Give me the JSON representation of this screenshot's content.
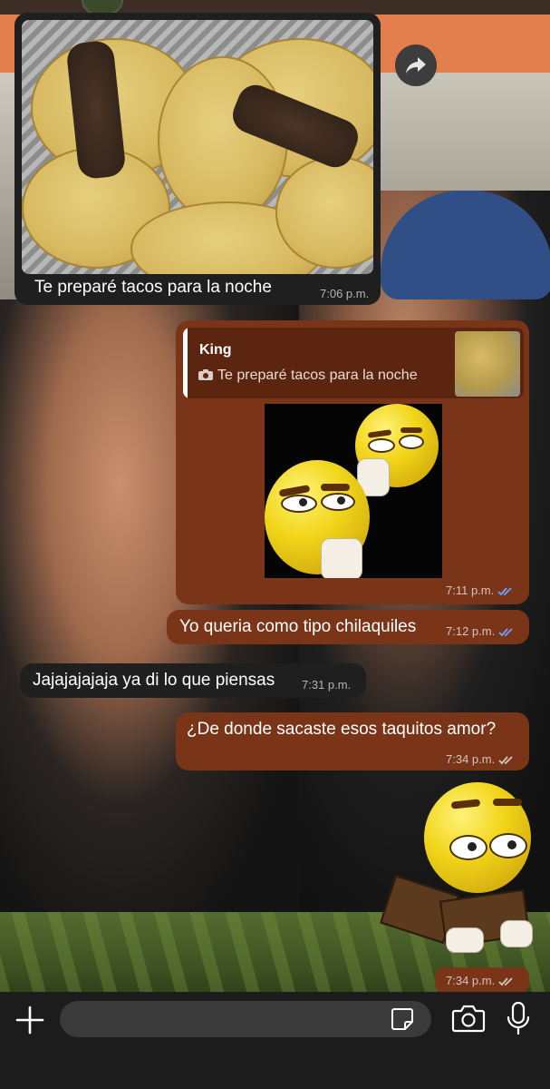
{
  "colors": {
    "outgoing_bubble": "#7a3519",
    "incoming_bubble": "#1f1f1f",
    "read_tick": "#6aa3ff",
    "composer_bg": "#1c1c1c"
  },
  "messages": [
    {
      "id": "m1",
      "direction": "incoming",
      "type": "image",
      "caption": "Te preparé tacos para la noche",
      "time": "7:06 p.m."
    },
    {
      "id": "m2",
      "direction": "outgoing",
      "type": "image-reply",
      "reply_to": {
        "sender": "King",
        "text": "Te preparé tacos para la noche",
        "icon": "camera-icon"
      },
      "time": "7:11 p.m.",
      "status": "read"
    },
    {
      "id": "m3",
      "direction": "outgoing",
      "type": "text",
      "text": "Yo queria como tipo chilaquiles",
      "time": "7:12 p.m.",
      "status": "read"
    },
    {
      "id": "m4",
      "direction": "incoming",
      "type": "text",
      "text": "Jajajajajaja ya di lo que piensas",
      "time": "7:31 p.m."
    },
    {
      "id": "m5",
      "direction": "outgoing",
      "type": "text",
      "text": "¿De donde sacaste esos taquitos amor?",
      "time": "7:34 p.m.",
      "status": "delivered"
    },
    {
      "id": "m6",
      "direction": "outgoing",
      "type": "sticker",
      "time": "7:34 p.m.",
      "status": "delivered"
    }
  ],
  "composer": {
    "placeholder": "",
    "icons": [
      "plus-icon",
      "sticker-icon",
      "camera-icon",
      "microphone-icon"
    ]
  }
}
